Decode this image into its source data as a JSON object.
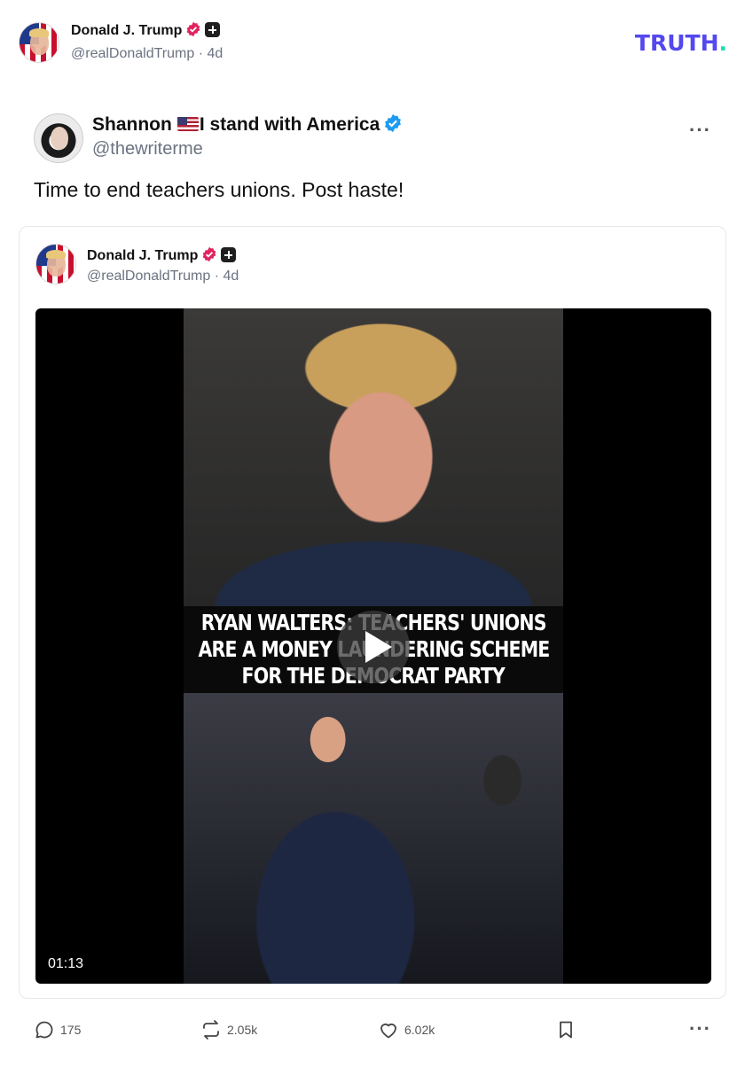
{
  "header": {
    "author_name": "Donald J. Trump",
    "author_handle": "@realDonaldTrump",
    "time_ago": "· 4d",
    "logo_text": "TRUTH",
    "logo_dot": "."
  },
  "quoted_post": {
    "author_name": "Shannon",
    "author_name_suffix": "I stand with America",
    "author_handle": "@thewriterme",
    "text": "Time to end teachers unions. Post haste!",
    "more_label": "···"
  },
  "embed": {
    "author_name": "Donald J. Trump",
    "author_handle": "@realDonaldTrump",
    "time_ago": "· 4d",
    "video": {
      "caption_lines": [
        "RYAN WALTERS: TEACHERS' UNIONS",
        "ARE A MONEY LAUNDERING SCHEME",
        "FOR THE DEMOCRAT PARTY"
      ],
      "duration": "01:13"
    }
  },
  "actions": {
    "replies": "175",
    "retruths": "2.05k",
    "likes": "6.02k",
    "more_label": "···"
  },
  "colors": {
    "brand_purple": "#5448ee",
    "brand_teal": "#17e0b2",
    "verified_blue": "#1d9bf0",
    "verified_red": "#e0245e"
  }
}
